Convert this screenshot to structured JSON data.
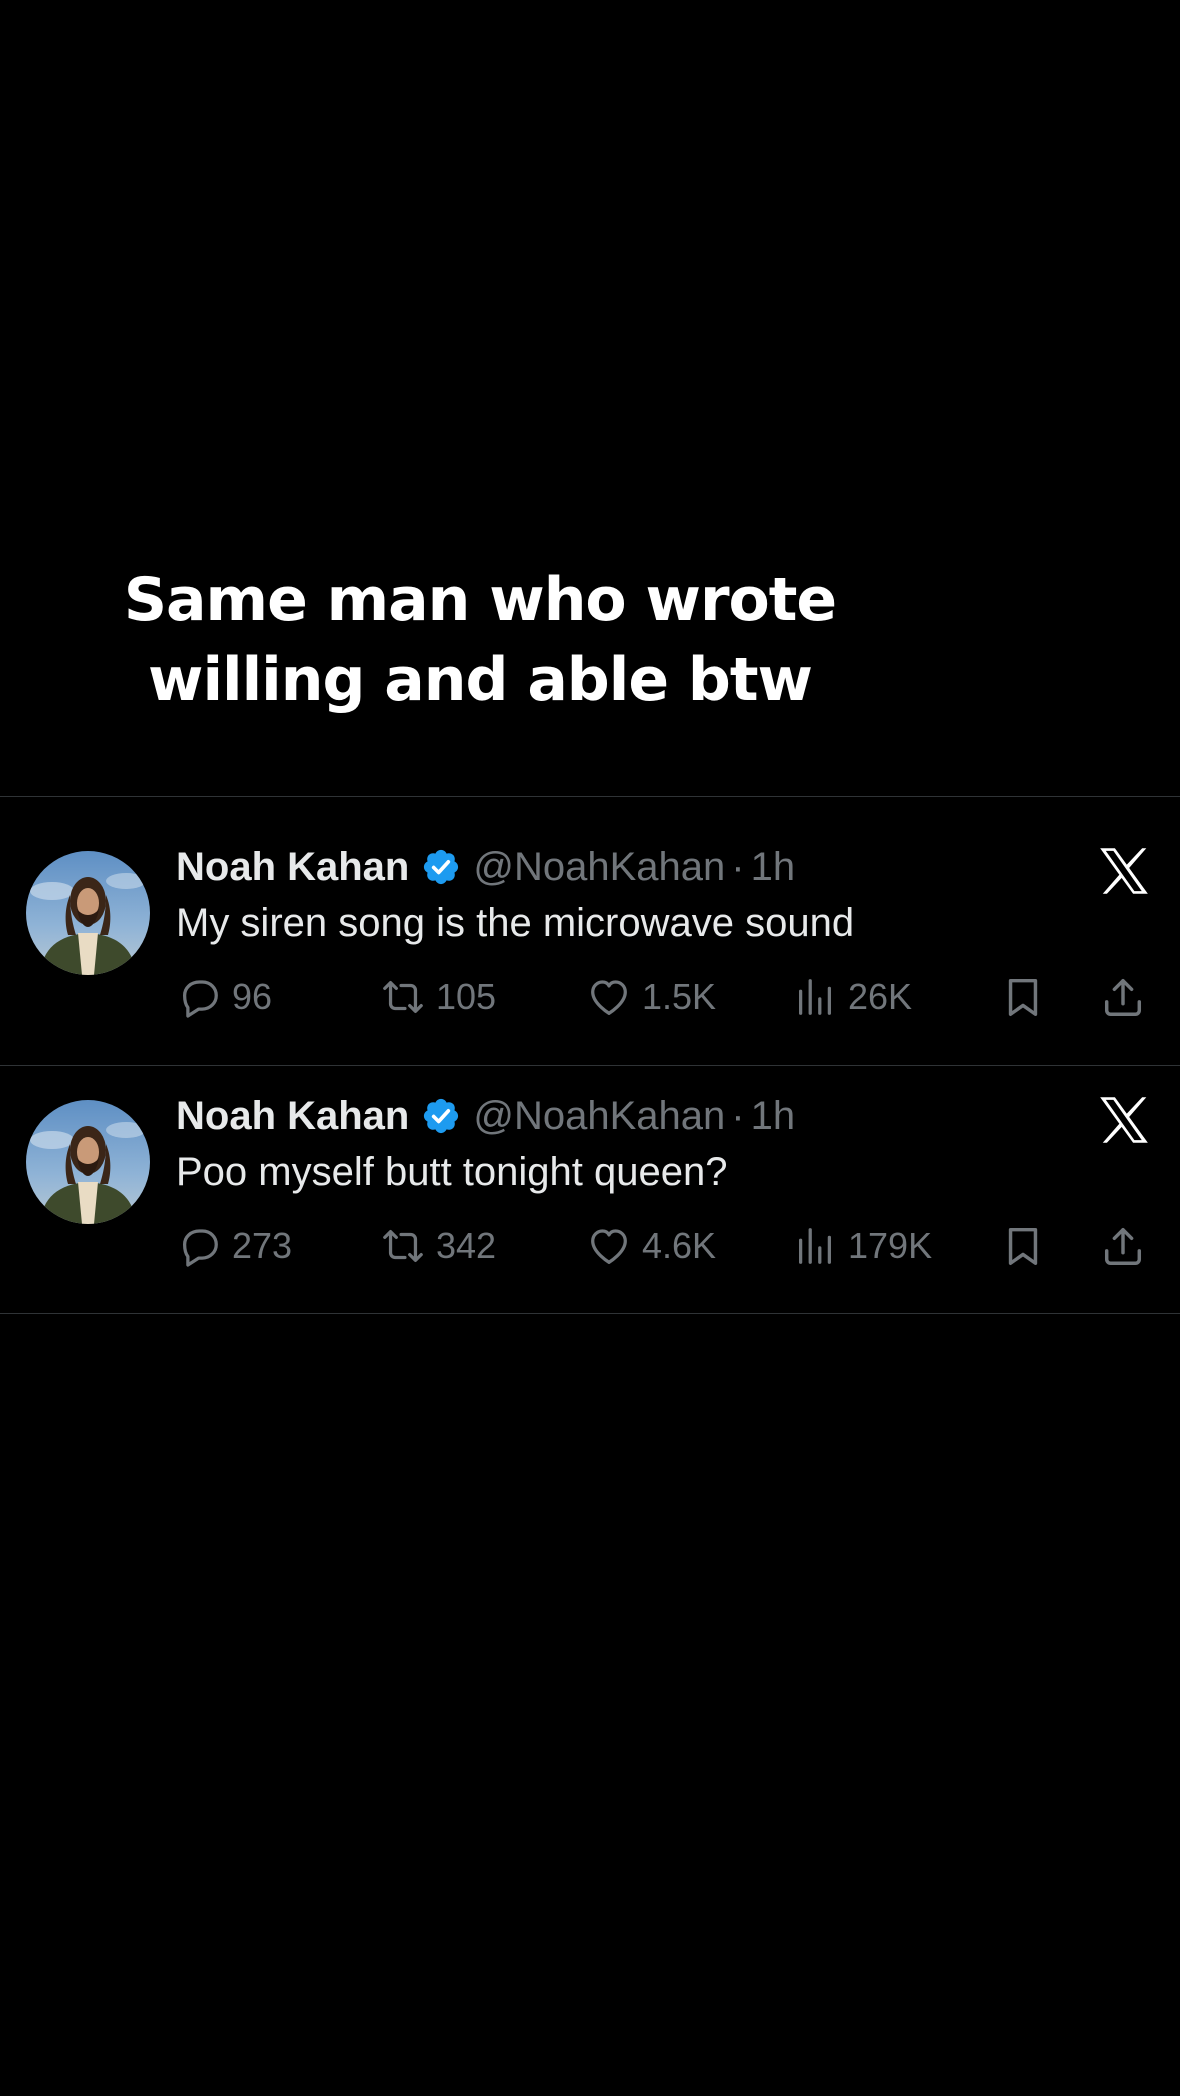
{
  "caption": {
    "line1": "Same man who wrote",
    "line2": "willing and able btw"
  },
  "colors": {
    "background": "#000000",
    "text_primary": "#e7e9ea",
    "text_secondary": "#71767b",
    "verified_blue": "#1d9bf0",
    "divider": "#2f3336"
  },
  "tweets": [
    {
      "display_name": "Noah Kahan",
      "handle": "@NoahKahan",
      "separator": "·",
      "time": "1h",
      "text": "My siren song is the microwave sound",
      "replies": "96",
      "retweets": "105",
      "likes": "1.5K",
      "views": "26K"
    },
    {
      "display_name": "Noah Kahan",
      "handle": "@NoahKahan",
      "separator": "·",
      "time": "1h",
      "text": "Poo myself butt tonight queen?",
      "replies": "273",
      "retweets": "342",
      "likes": "4.6K",
      "views": "179K"
    }
  ],
  "icons": {
    "avatar": "avatar",
    "verified": "verified-badge-icon",
    "platform": "x-logo-icon",
    "reply": "reply-icon",
    "retweet": "retweet-icon",
    "like": "heart-icon",
    "views": "views-chart-icon",
    "bookmark": "bookmark-icon",
    "share": "share-icon"
  }
}
